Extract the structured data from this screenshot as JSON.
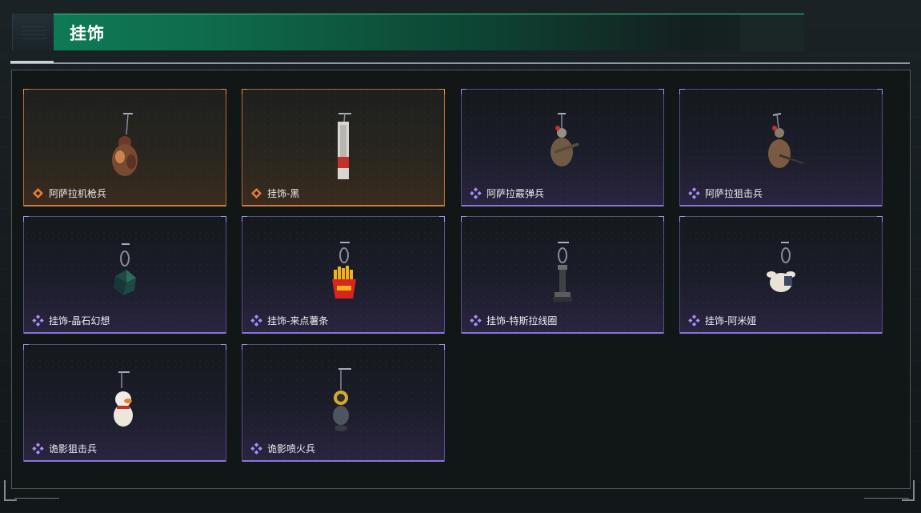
{
  "header": {
    "title": "挂饰"
  },
  "colors": {
    "accent_green": "#0e7a55",
    "rarity_orange": "#d07a3e",
    "rarity_purple": "#8b75d6"
  },
  "items": [
    {
      "label": "阿萨拉机枪兵",
      "rarity": "orange",
      "icon": "soldier-charm-icon"
    },
    {
      "label": "挂饰-黑",
      "rarity": "orange",
      "icon": "blade-tag-charm-icon"
    },
    {
      "label": "阿萨拉霰弹兵",
      "rarity": "purple",
      "icon": "soldier-charm-icon"
    },
    {
      "label": "阿萨拉狙击兵",
      "rarity": "purple",
      "icon": "soldier-charm-icon"
    },
    {
      "label": "挂饰-晶石幻想",
      "rarity": "purple",
      "icon": "crystal-cube-charm-icon"
    },
    {
      "label": "挂饰-来点薯条",
      "rarity": "purple",
      "icon": "fries-charm-icon"
    },
    {
      "label": "挂饰-特斯拉线圈",
      "rarity": "purple",
      "icon": "tesla-coil-charm-icon"
    },
    {
      "label": "挂饰-阿米娅",
      "rarity": "purple",
      "icon": "plush-charm-icon"
    },
    {
      "label": "诡影狙击兵",
      "rarity": "purple",
      "icon": "duck-charm-icon"
    },
    {
      "label": "诡影喷火兵",
      "rarity": "purple",
      "icon": "astronaut-charm-icon"
    }
  ]
}
